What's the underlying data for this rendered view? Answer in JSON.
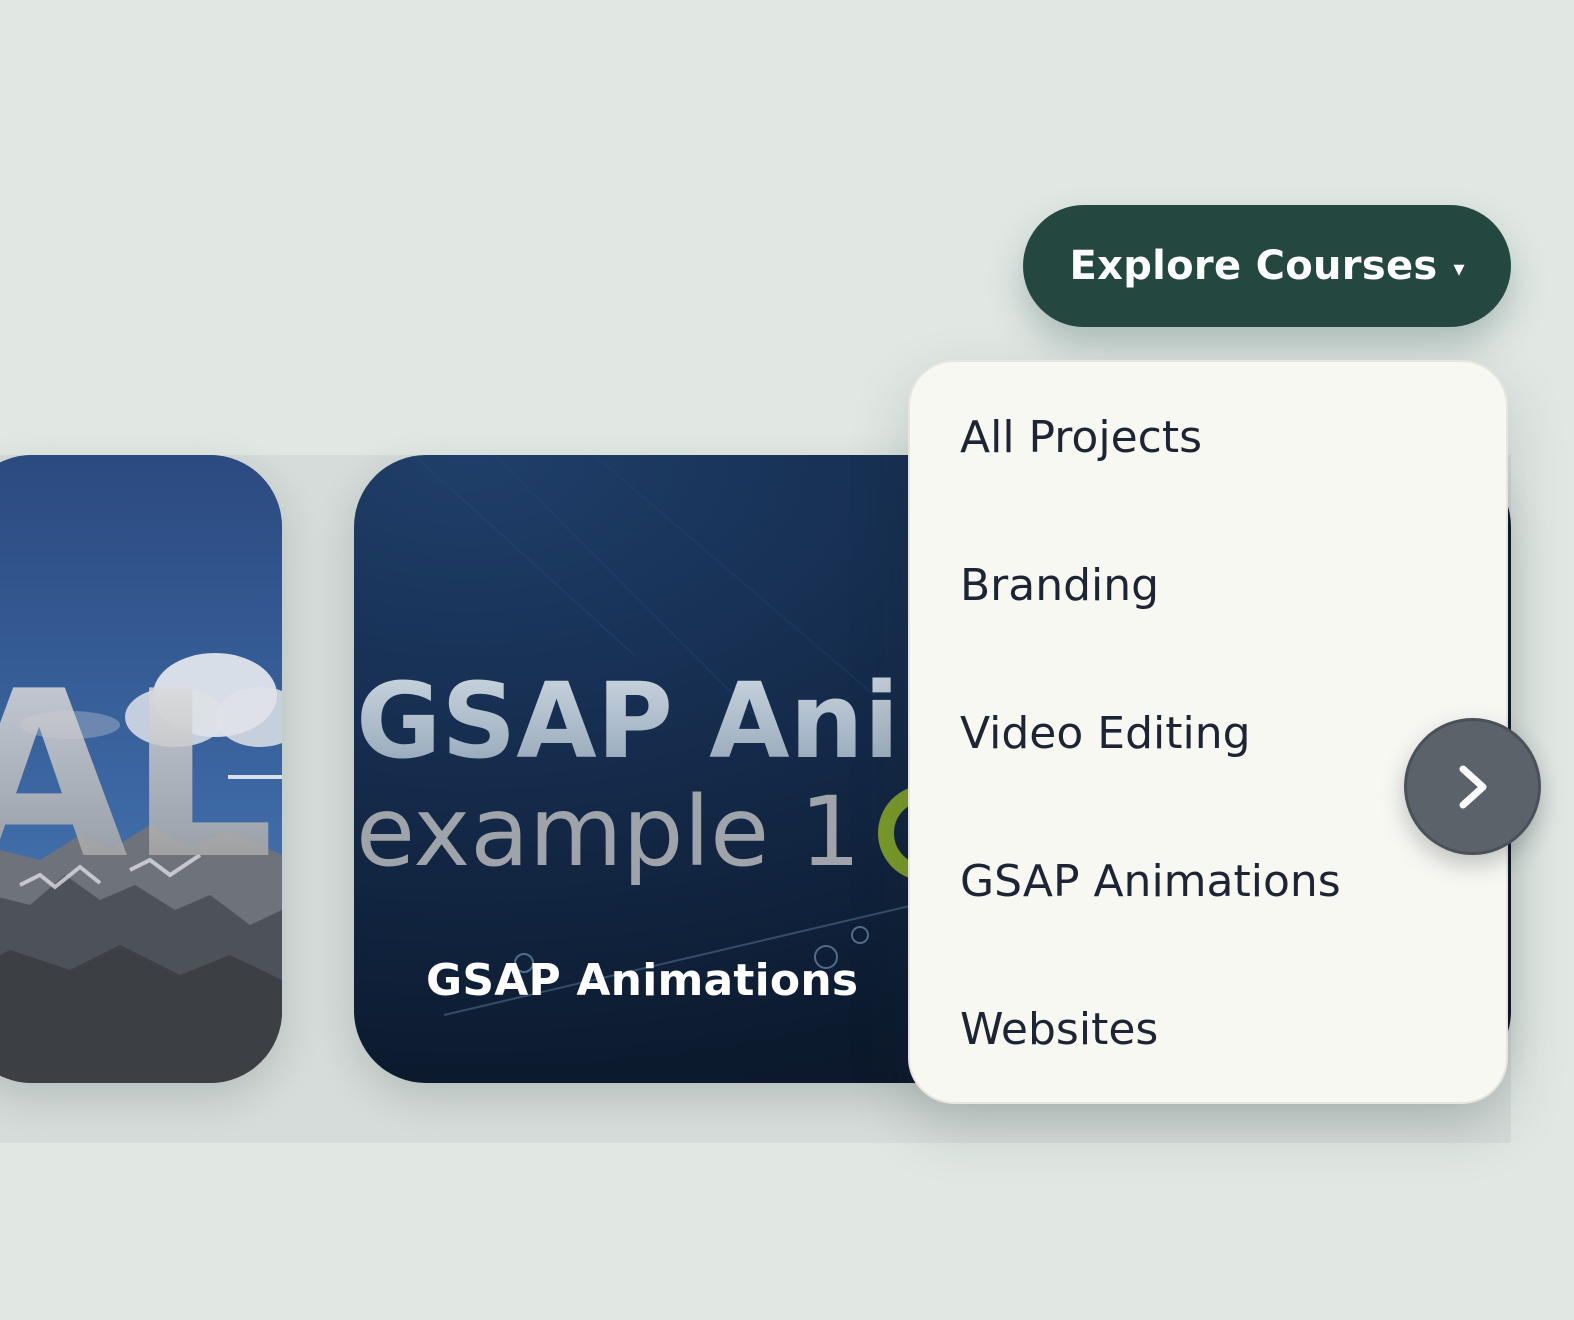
{
  "header": {
    "explore_button": {
      "label": "Explore Courses",
      "caret": "▾"
    }
  },
  "dropdown": {
    "items": [
      {
        "label": "All Projects"
      },
      {
        "label": "Branding"
      },
      {
        "label": "Video Editing"
      },
      {
        "label": "GSAP Animations"
      },
      {
        "label": "Websites"
      }
    ]
  },
  "carousel": {
    "cards": [
      {
        "thumbnail_text": "AL",
        "thumbnail": "mountain-sky-graphic"
      },
      {
        "title": "GSAP Animations",
        "thumbnail_text_line1": "GSAP Anim",
        "thumbnail_text_line2": "example 1",
        "thumbnail": "dark-blue-title-graphic"
      }
    ],
    "next_icon": "chevron-right-icon"
  },
  "colors": {
    "page_background": "#e1e8e4",
    "button_background": "#244840",
    "dropdown_background": "#f8f8f3",
    "menu_text": "#1d2434",
    "next_button": "#5a626a"
  }
}
